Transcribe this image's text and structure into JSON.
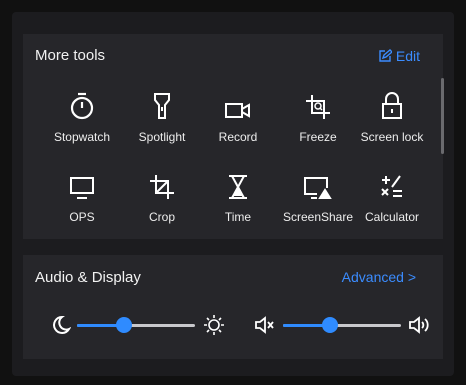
{
  "more_tools": {
    "title": "More tools",
    "edit_label": "Edit",
    "tools": [
      {
        "label": "Stopwatch",
        "icon": "stopwatch-icon"
      },
      {
        "label": "Spotlight",
        "icon": "spotlight-icon"
      },
      {
        "label": "Record",
        "icon": "record-icon"
      },
      {
        "label": "Freeze",
        "icon": "freeze-icon"
      },
      {
        "label": "Screen lock",
        "icon": "lock-icon"
      },
      {
        "label": "OPS",
        "icon": "monitor-icon"
      },
      {
        "label": "Crop",
        "icon": "crop-icon"
      },
      {
        "label": "Time",
        "icon": "hourglass-icon"
      },
      {
        "label": "ScreenShare",
        "icon": "screenshare-icon"
      },
      {
        "label": "Calculator",
        "icon": "calculator-icon"
      }
    ]
  },
  "audio_display": {
    "title": "Audio & Display",
    "advanced_label": "Advanced >",
    "brightness_level": 0.4,
    "volume_level": 0.4
  },
  "colors": {
    "accent": "#2f8bff",
    "panel": "#1c1c1f",
    "card": "#26262a"
  }
}
